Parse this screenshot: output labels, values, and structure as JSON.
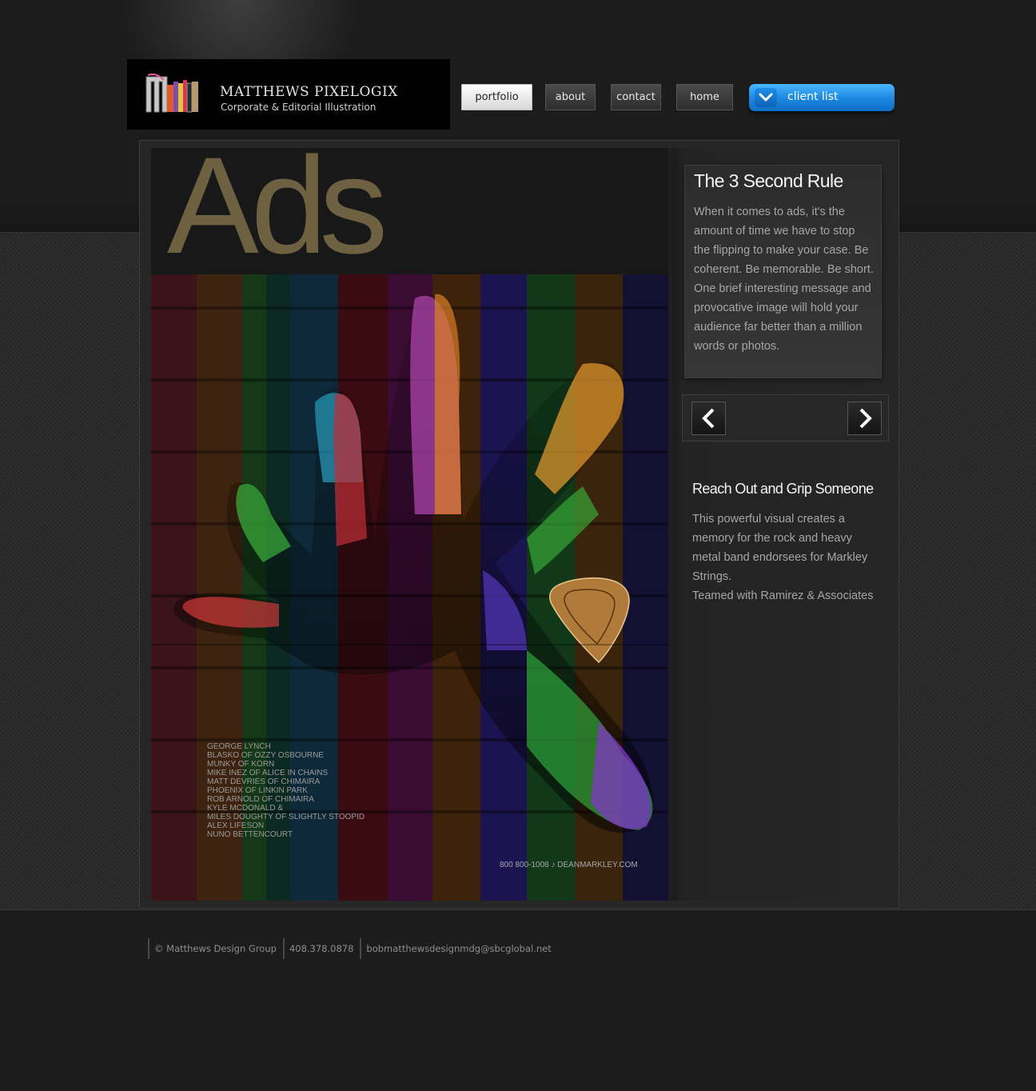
{
  "header": {
    "logo_name": "MATTHEWS PIXELOGIX",
    "logo_tagline": "Corporate & Editorial Illustration"
  },
  "nav": {
    "portfolio": "portfolio",
    "about": "about",
    "contact": "contact",
    "home": "home",
    "client_list": "client list"
  },
  "main": {
    "section_title": "Ads",
    "ad": {
      "endorsers": [
        "George Lynch",
        "Blasko of Ozzy Osbourne",
        "Munky of Korn",
        "Mike Inez of Alice in Chains",
        "Matt DeVries of Chimaira",
        "Phoenix of Linkin Park",
        "Rob Arnold of Chimaira",
        "Kyle McDonald &",
        "Miles Doughty of Slightly Stoopid",
        "Alex Lifeson",
        "Nuno Bettencourt"
      ],
      "contact_line": "800 800-1008 ♪ DEANMARKLEY.COM"
    }
  },
  "sidebar": {
    "card1": {
      "title": "The 3 Second Rule",
      "body": "When it comes to ads, it's the amount of time we have to stop the flipping to make your case. Be coherent. Be memorable. Be short. One brief interesting message and provocative image will hold your audience far better than a million words or photos."
    },
    "card2": {
      "title": "Reach Out and Grip Someone",
      "body": "This powerful visual creates a memory for the rock and heavy metal band endorsees for Markley Strings.",
      "credit": "Teamed with Ramirez & Associates"
    }
  },
  "footer": {
    "copyright": "© Matthews Design Group",
    "phone": "408.378.0878",
    "email": "bobmatthewsdesignmdg@sbcglobal.net"
  },
  "colors": {
    "accent_blue": "#1a86e0",
    "ads_title": "#6e6141",
    "background": "#1c1c1c"
  }
}
